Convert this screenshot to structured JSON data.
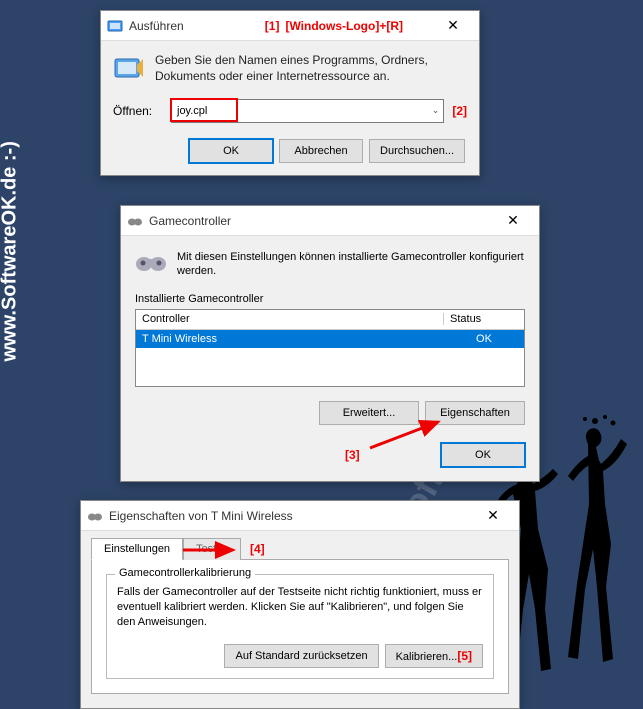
{
  "watermark": {
    "left": "www.SoftwareOK.de :-)",
    "diag": "SoftwareOK.de"
  },
  "annotations": {
    "a1": "[1]",
    "a1_hint": "[Windows-Logo]+[R]",
    "a2": "[2]",
    "a3": "[3]",
    "a4": "[4]",
    "a5": "[5]"
  },
  "run": {
    "title": "Ausführen",
    "description": "Geben Sie den Namen eines Programms, Ordners, Dokuments oder einer Internetressource an.",
    "open_label": "Öffnen:",
    "value": "joy.cpl",
    "ok": "OK",
    "cancel": "Abbrechen",
    "browse": "Durchsuchen..."
  },
  "gamecontroller": {
    "title": "Gamecontroller",
    "description": "Mit diesen Einstellungen können installierte Gamecontroller konfiguriert werden.",
    "list_label": "Installierte Gamecontroller",
    "col_controller": "Controller",
    "col_status": "Status",
    "rows": [
      {
        "name": "T Mini Wireless",
        "status": "OK"
      }
    ],
    "advanced": "Erweitert...",
    "properties": "Eigenschaften",
    "ok": "OK"
  },
  "properties": {
    "title": "Eigenschaften von T Mini Wireless",
    "tab_settings": "Einstellungen",
    "tab_test": "Testen",
    "group_title": "Gamecontrollerkalibrierung",
    "group_desc": "Falls der Gamecontroller auf der Testseite nicht richtig funktioniert, muss er eventuell kalibriert werden. Klicken Sie auf \"Kalibrieren\", und folgen Sie den Anweisungen.",
    "reset": "Auf Standard zurücksetzen",
    "calibrate": "Kalibrieren..."
  }
}
